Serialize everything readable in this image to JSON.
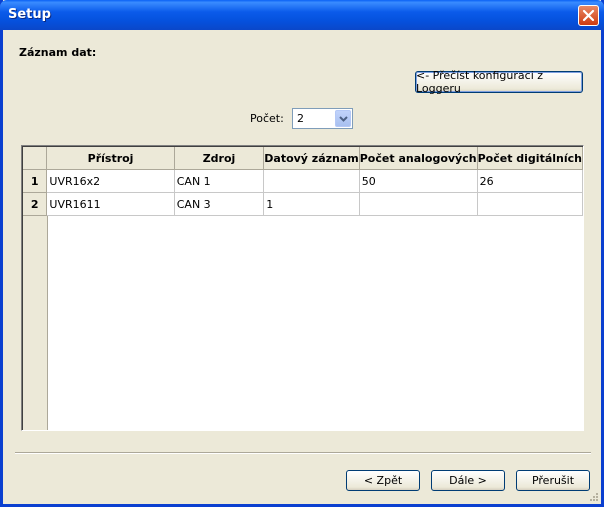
{
  "window": {
    "title": "Setup"
  },
  "section_label": "Záznam dat:",
  "read_config_button": "<- Přečíst konfiguraci z Loggeru",
  "count": {
    "label": "Počet:",
    "value": "2"
  },
  "table": {
    "columns": [
      "Přístroj",
      "Zdroj",
      "Datový záznam",
      "Počet analogových",
      "Počet digitálních"
    ],
    "rows": [
      {
        "num": "1",
        "cells": [
          "UVR16x2",
          "CAN 1",
          "",
          "50",
          "26"
        ]
      },
      {
        "num": "2",
        "cells": [
          "UVR1611",
          "CAN 3",
          "1",
          "",
          ""
        ]
      }
    ]
  },
  "buttons": {
    "back": "< Zpět",
    "next": "Dále >",
    "abort": "Přerušit"
  },
  "colors": {
    "titlebar": "#0b5bea",
    "close": "#cf3b10",
    "dialog_bg": "#ece9d8"
  },
  "icons": {
    "close": "close-icon",
    "dropdown": "chevron-down-icon",
    "resize": "resize-grip-icon"
  }
}
